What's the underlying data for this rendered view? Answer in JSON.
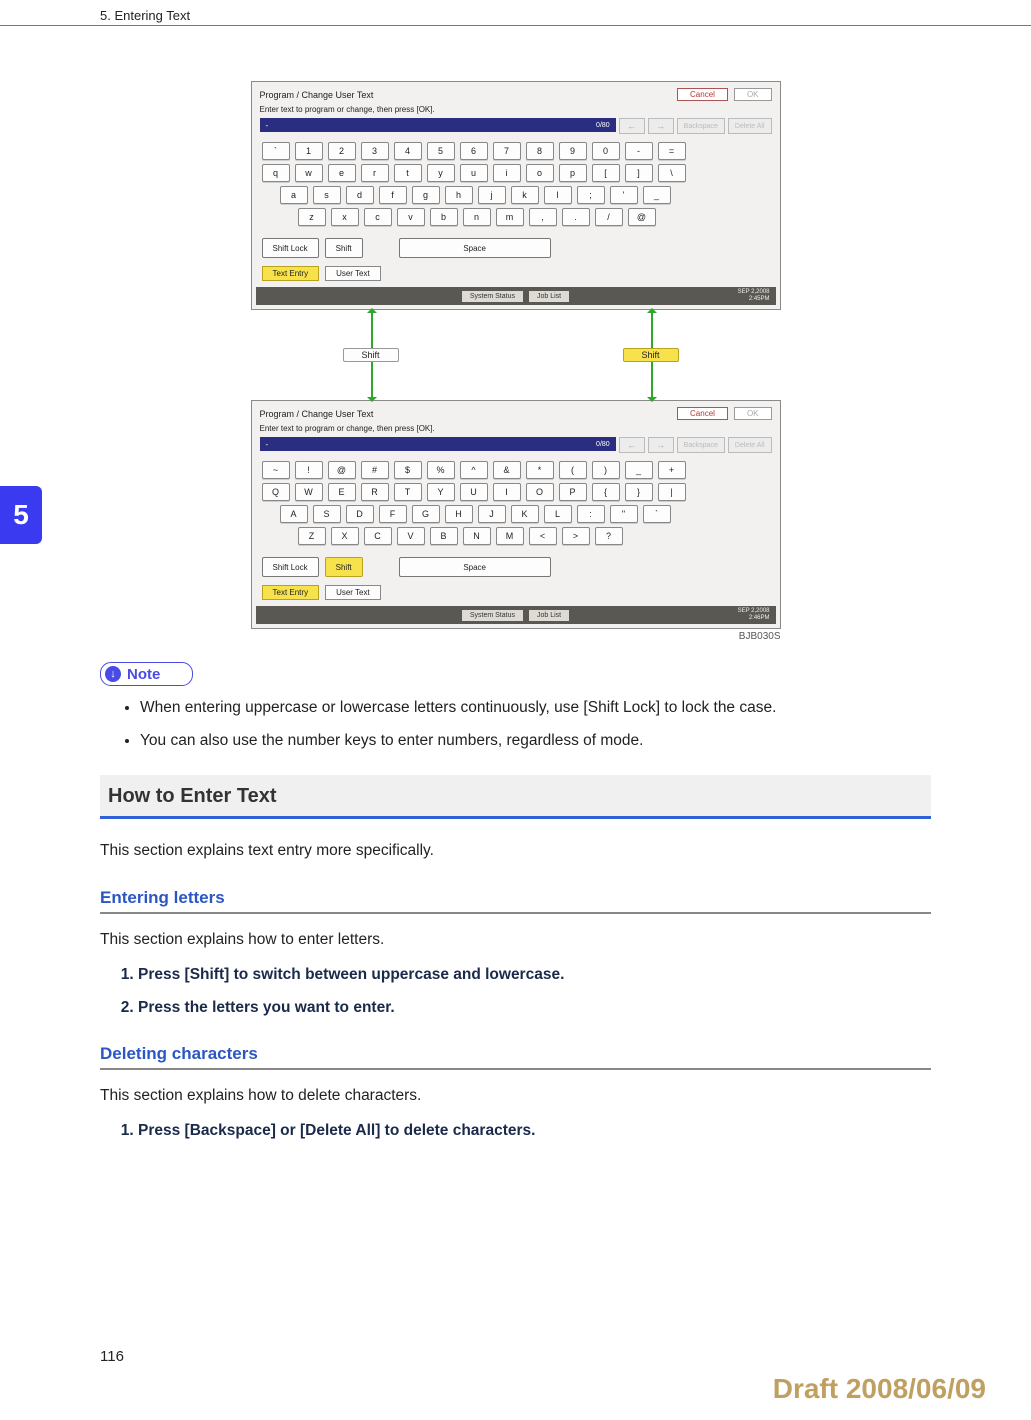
{
  "header": {
    "chapter_line": "5. Entering Text",
    "tab": "5"
  },
  "page_number": "116",
  "draft": "Draft 2008/06/09",
  "figure": {
    "code": "BJB030S",
    "panel_title": "Program / Change User Text",
    "cancel": "Cancel",
    "ok": "OK",
    "instruction": "Enter text to program or change, then press [OK].",
    "input_dash": "-",
    "input_count": "0/80",
    "backspace": "Backspace",
    "delete_all": "Delete All",
    "shift_lock": "Shift Lock",
    "shift": "Shift",
    "space": "Space",
    "text_entry": "Text Entry",
    "user_text": "User Text",
    "system_status": "System Status",
    "job_list": "Job List",
    "date1": "SEP   2,2008",
    "time1": "2:45PM",
    "time2": "2:46PM",
    "lower": {
      "r1": [
        "`",
        "1",
        "2",
        "3",
        "4",
        "5",
        "6",
        "7",
        "8",
        "9",
        "0",
        "-",
        "="
      ],
      "r2": [
        "q",
        "w",
        "e",
        "r",
        "t",
        "y",
        "u",
        "i",
        "o",
        "p",
        "[",
        "]",
        "\\"
      ],
      "r3": [
        "a",
        "s",
        "d",
        "f",
        "g",
        "h",
        "j",
        "k",
        "l",
        ";",
        "'",
        "_"
      ],
      "r4": [
        "z",
        "x",
        "c",
        "v",
        "b",
        "n",
        "m",
        ",",
        ".",
        "/",
        "@"
      ]
    },
    "upper": {
      "r1": [
        "~",
        "!",
        "@",
        "#",
        "$",
        "%",
        "^",
        "&",
        "*",
        "(",
        ")",
        "_",
        "+"
      ],
      "r2": [
        "Q",
        "W",
        "E",
        "R",
        "T",
        "Y",
        "U",
        "I",
        "O",
        "P",
        "{",
        "}",
        "|"
      ],
      "r3": [
        "A",
        "S",
        "D",
        "F",
        "G",
        "H",
        "J",
        "K",
        "L",
        ":",
        "\"",
        "`"
      ],
      "r4": [
        "Z",
        "X",
        "C",
        "V",
        "B",
        "N",
        "M",
        "<",
        ">",
        "?"
      ]
    },
    "mid_shift_left": "Shift",
    "mid_shift_right": "Shift"
  },
  "note": {
    "label": "Note",
    "items": [
      "When entering uppercase or lowercase letters continuously, use [Shift Lock] to lock the case.",
      "You can also use the number keys to enter numbers, regardless of mode."
    ]
  },
  "sec_enter": {
    "title": "How to Enter Text",
    "intro": "This section explains text entry more specifically."
  },
  "sec_letters": {
    "title": "Entering letters",
    "intro": "This section explains how to enter letters.",
    "steps": [
      "Press [Shift] to switch between uppercase and lowercase.",
      "Press the letters you want to enter."
    ]
  },
  "sec_delete": {
    "title": "Deleting characters",
    "intro": "This section explains how to delete characters.",
    "steps": [
      "Press [Backspace] or [Delete All] to delete characters."
    ]
  }
}
